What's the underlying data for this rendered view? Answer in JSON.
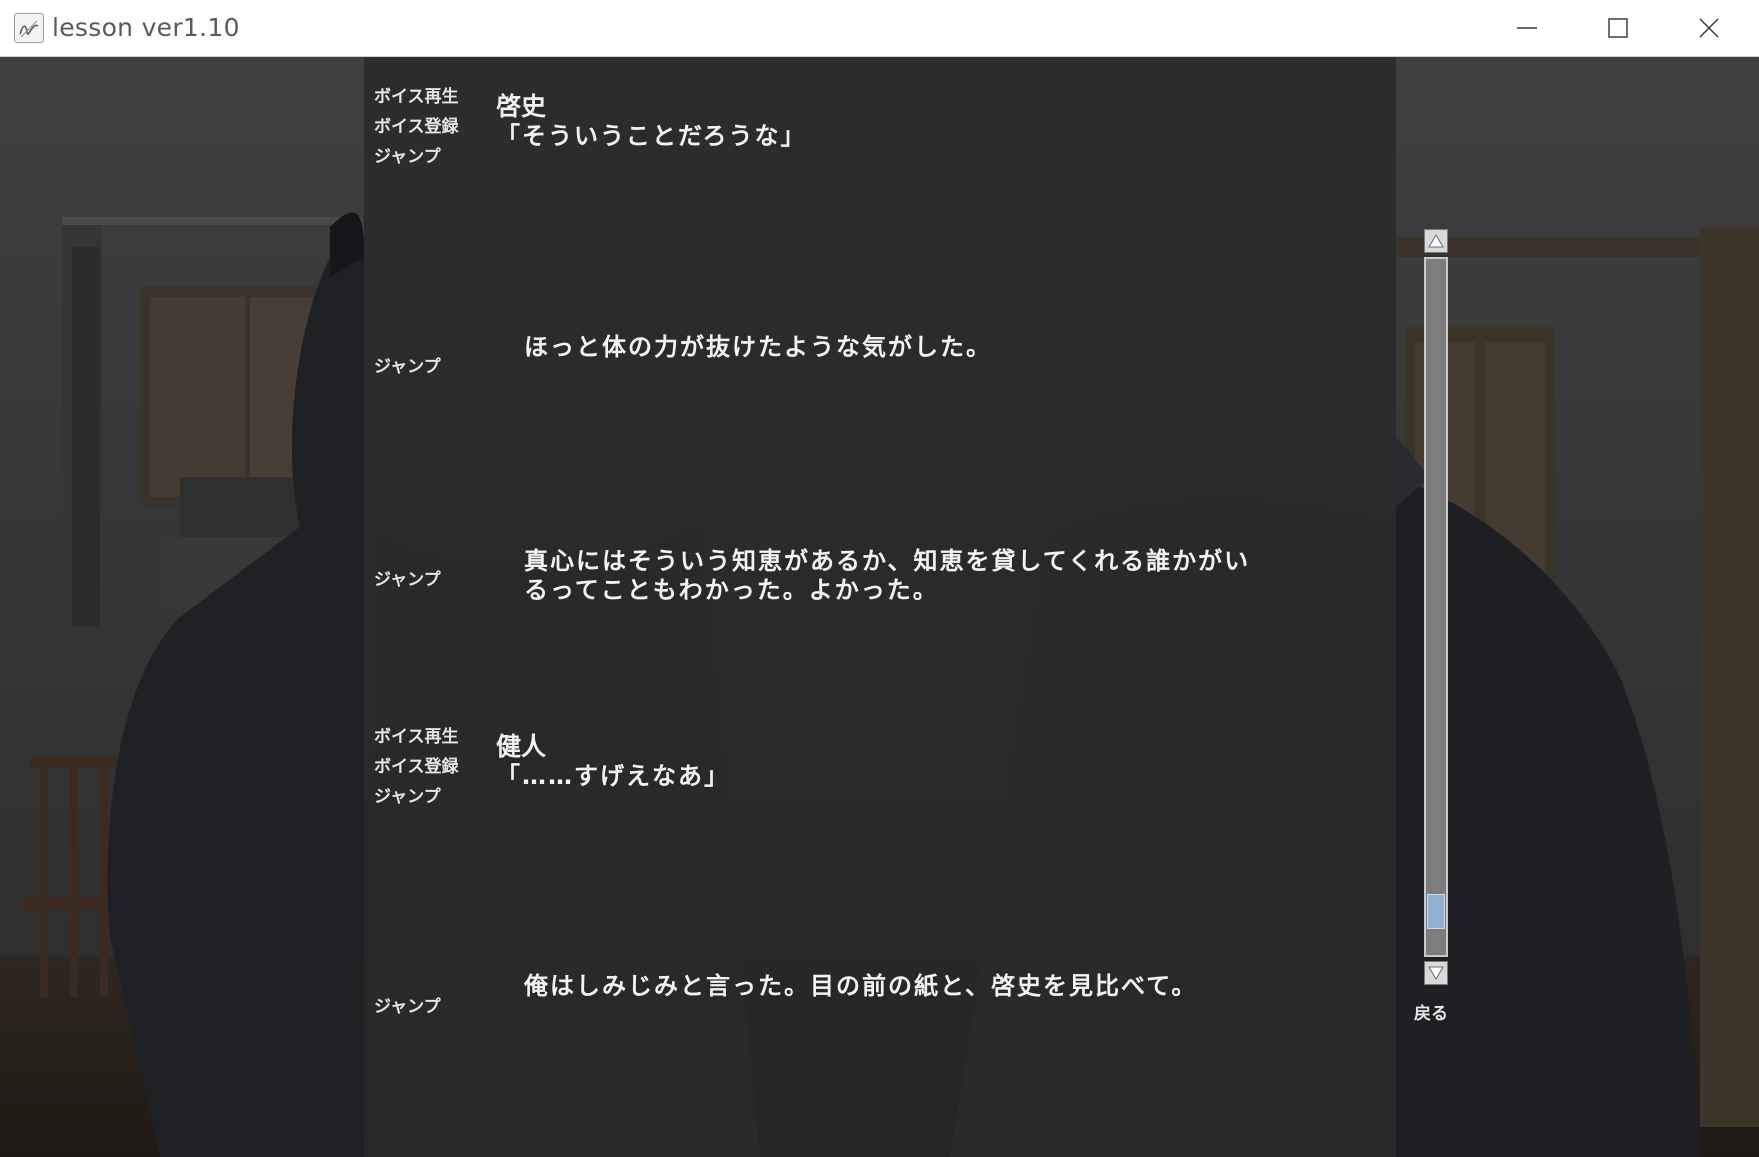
{
  "window": {
    "title": "lesson ver1.10",
    "icon": "app-logo-icon",
    "controls": [
      "minimize-icon",
      "maximize-icon",
      "close-icon"
    ]
  },
  "log": {
    "entries": [
      {
        "buttons": [
          "ボイス再生",
          "ボイス登録",
          "ジャンプ"
        ],
        "speaker": "啓史",
        "text": "「そういうことだろうな」"
      },
      {
        "buttons": [
          "ジャンプ"
        ],
        "speaker": "",
        "text": "ほっと体の力が抜けたような気がした。"
      },
      {
        "buttons": [
          "ジャンプ"
        ],
        "speaker": "",
        "text": "真心にはそういう知恵があるか、知恵を貸してくれる誰かがい\nるってこともわかった。よかった。"
      },
      {
        "buttons": [
          "ボイス再生",
          "ボイス登録",
          "ジャンプ"
        ],
        "speaker": "健人",
        "text": "「……すげえなあ」"
      },
      {
        "buttons": [
          "ジャンプ"
        ],
        "speaker": "",
        "text": "俺はしみじみと言った。目の前の紙と、啓史を見比べて。"
      }
    ]
  },
  "scrollbar": {
    "position": 0.95,
    "up_icon": "arrow-up-icon",
    "down_icon": "arrow-down-icon"
  },
  "back_label": "戻る"
}
